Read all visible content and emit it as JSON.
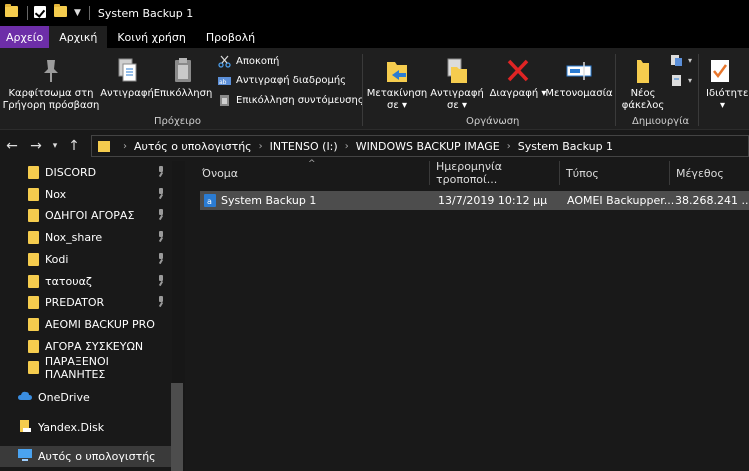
{
  "window": {
    "title": "System Backup 1"
  },
  "tabs": {
    "file": "Αρχείο",
    "home": "Αρχική",
    "share": "Κοινή χρήση",
    "view": "Προβολή"
  },
  "ribbon": {
    "pin_quick_access": [
      "Καρφίτσωμα στη",
      "Γρήγορη πρόσβαση"
    ],
    "copy": "Αντιγραφή",
    "paste": "Επικόλληση",
    "cut": "Αποκοπή",
    "copy_path": "Αντιγραφή διαδρομής",
    "paste_shortcut": "Επικόλληση συντόμευσης",
    "clipboard_group": "Πρόχειρο",
    "move_to": [
      "Μετακίνηση",
      "σε"
    ],
    "copy_to": [
      "Αντιγραφή",
      "σε"
    ],
    "delete": "Διαγραφή",
    "rename": "Μετονομασία",
    "organize_group": "Οργάνωση",
    "new_folder": [
      "Νέος",
      "φάκελος"
    ],
    "new_group": "Δημιουργία",
    "properties": "Ιδιότητε"
  },
  "address": {
    "crumbs": [
      "Αυτός ο υπολογιστής",
      "INTENSO (I:)",
      "WINDOWS BACKUP IMAGE",
      "System Backup 1"
    ]
  },
  "nav": {
    "items": [
      {
        "label": "DISCORD",
        "pinned": true
      },
      {
        "label": "Nox",
        "pinned": true
      },
      {
        "label": "ΟΔΗΓΟΙ ΑΓΟΡΑΣ",
        "pinned": true
      },
      {
        "label": "Nox_share",
        "pinned": true
      },
      {
        "label": "Kodi",
        "pinned": true
      },
      {
        "label": "τατουαζ",
        "pinned": true
      },
      {
        "label": "PREDATOR",
        "pinned": true
      },
      {
        "label": "AEOMI BACKUP PRO",
        "pinned": false
      },
      {
        "label": "ΑΓΟΡΑ ΣΥΣΚΕΥΩΝ",
        "pinned": false
      },
      {
        "label": "ΠΑΡΑΞΕΝΟΙ ΠΛΑΝΗΤΕΣ",
        "pinned": false
      }
    ],
    "onedrive": "OneDrive",
    "yandex": "Yandex.Disk",
    "this_pc": "Αυτός ο υπολογιστής"
  },
  "columns": {
    "name": "Όνομα",
    "modified": "Ημερομηνία τροποποί...",
    "type": "Τύπος",
    "size": "Μέγεθος"
  },
  "files": [
    {
      "name": "System Backup 1",
      "modified": "13/7/2019 10:12 μμ",
      "type": "AOMEI Backupper...",
      "size": "38.268.241 ..."
    }
  ],
  "colors": {
    "file_tab": "#6d2ea8",
    "folder": "#f5cc4e",
    "selection": "#4d4d4d",
    "delete_red": "#e02424",
    "accent_blue": "#2b7cd3"
  }
}
